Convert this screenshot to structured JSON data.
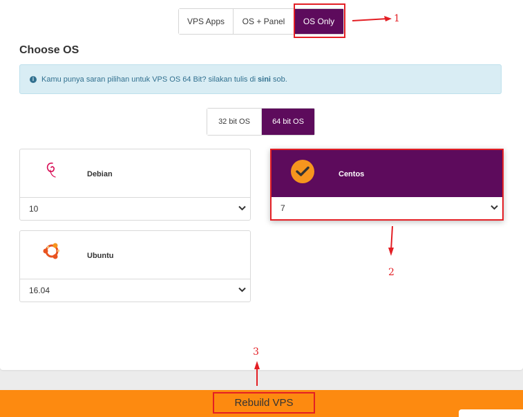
{
  "tabs": [
    {
      "label": "VPS Apps",
      "active": false
    },
    {
      "label": "OS + Panel",
      "active": false
    },
    {
      "label": "OS Only",
      "active": true
    }
  ],
  "section_title": "Choose OS",
  "alert": {
    "icon": "info-icon",
    "text_before": "Kamu punya saran pilihan untuk VPS OS 64 Bit? silakan tulis di",
    "link": "sini",
    "text_after": "sob."
  },
  "bit_tabs": [
    {
      "label": "32 bit OS",
      "active": false
    },
    {
      "label": "64 bit OS",
      "active": true
    }
  ],
  "os_options": [
    {
      "name": "Debian",
      "icon": "debian-swirl-icon",
      "version": "10",
      "selected": false
    },
    {
      "name": "Ubuntu",
      "icon": "ubuntu-logo-icon",
      "version": "16.04",
      "selected": false
    },
    {
      "name": "Centos",
      "icon": "checkmark-icon",
      "version": "7",
      "selected": true
    }
  ],
  "annotations": {
    "n1": "1",
    "n2": "2",
    "n3": "3",
    "color": "#e31e24"
  },
  "rebuild_button": "Rebuild VPS",
  "colors": {
    "accent": "#5d0b5c",
    "orange": "#fd8a10",
    "alert_bg": "#d9edf4"
  }
}
